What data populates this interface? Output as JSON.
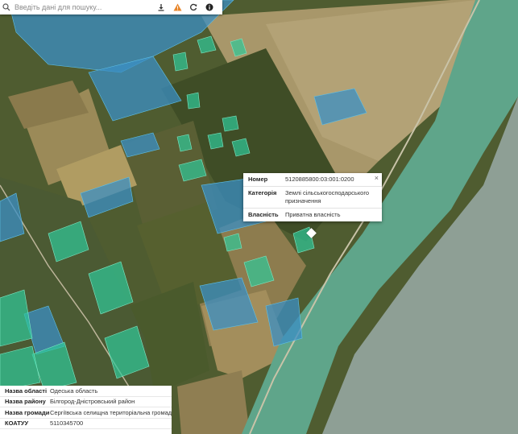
{
  "search": {
    "placeholder": "Введіть дані для пошуку..."
  },
  "toolbar": {
    "search_icon": "search-icon",
    "download_icon": "download-icon",
    "warning_icon": "warning-icon",
    "refresh_icon": "refresh-icon",
    "info_icon": "info-icon"
  },
  "popup": {
    "close": "×",
    "rows": [
      {
        "key": "Номер",
        "value": "5120885800:03:001:0200"
      },
      {
        "key": "Категорія",
        "value": "Землі сільськогосподарського призначення"
      },
      {
        "key": "Власність",
        "value": "Приватна власність"
      }
    ]
  },
  "info": {
    "rows": [
      {
        "key": "Назва області",
        "value": "Одеська область"
      },
      {
        "key": "Назва району",
        "value": "Білгород-Дністровський район"
      },
      {
        "key": "Назва громади",
        "value": "Сергіївська селищна територіальна громада"
      },
      {
        "key": "КОАТУУ",
        "value": "5110345700"
      }
    ]
  },
  "colors": {
    "parcel_blue": "#3b8fc4",
    "parcel_green": "#2fc99a",
    "water": "#8a9a8e",
    "field_dark": "#4d5a2e",
    "field_light": "#a89560"
  }
}
